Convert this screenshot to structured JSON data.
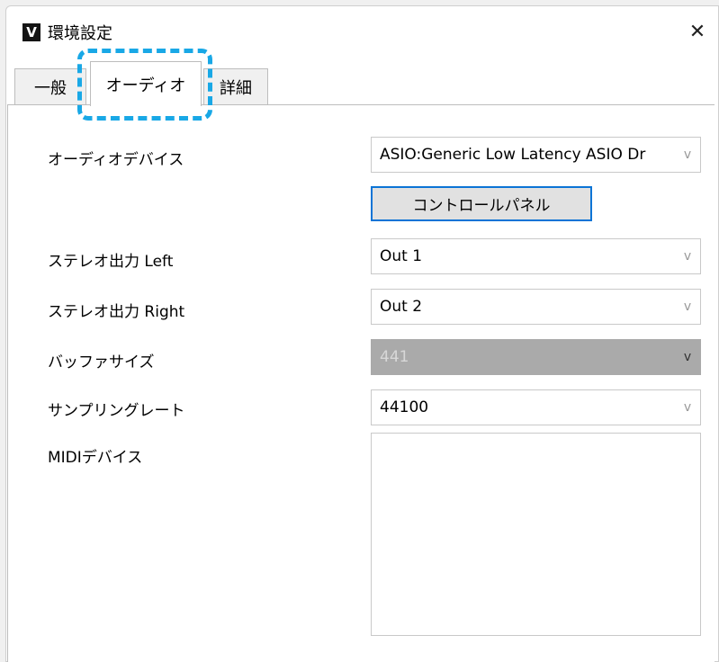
{
  "window": {
    "app_icon": "V",
    "title": "環境設定",
    "close_symbol": "✕"
  },
  "tabs": [
    {
      "label": "一般",
      "active": false
    },
    {
      "label": "オーディオ",
      "active": true
    },
    {
      "label": "詳細",
      "active": false
    }
  ],
  "highlight_color": "#19a8e6",
  "audio": {
    "device_label": "オーディオデバイス",
    "device_value": "ASIO:Generic Low Latency ASIO Dr",
    "control_panel_button": "コントロールパネル",
    "stereo_left_label": "ステレオ出力 Left",
    "stereo_left_value": "Out 1",
    "stereo_right_label": "ステレオ出力 Right",
    "stereo_right_value": "Out 2",
    "buffer_label": "バッファサイズ",
    "buffer_value": "441",
    "sample_rate_label": "サンプリングレート",
    "sample_rate_value": "44100",
    "midi_label": "MIDIデバイス"
  },
  "chevron": "v"
}
